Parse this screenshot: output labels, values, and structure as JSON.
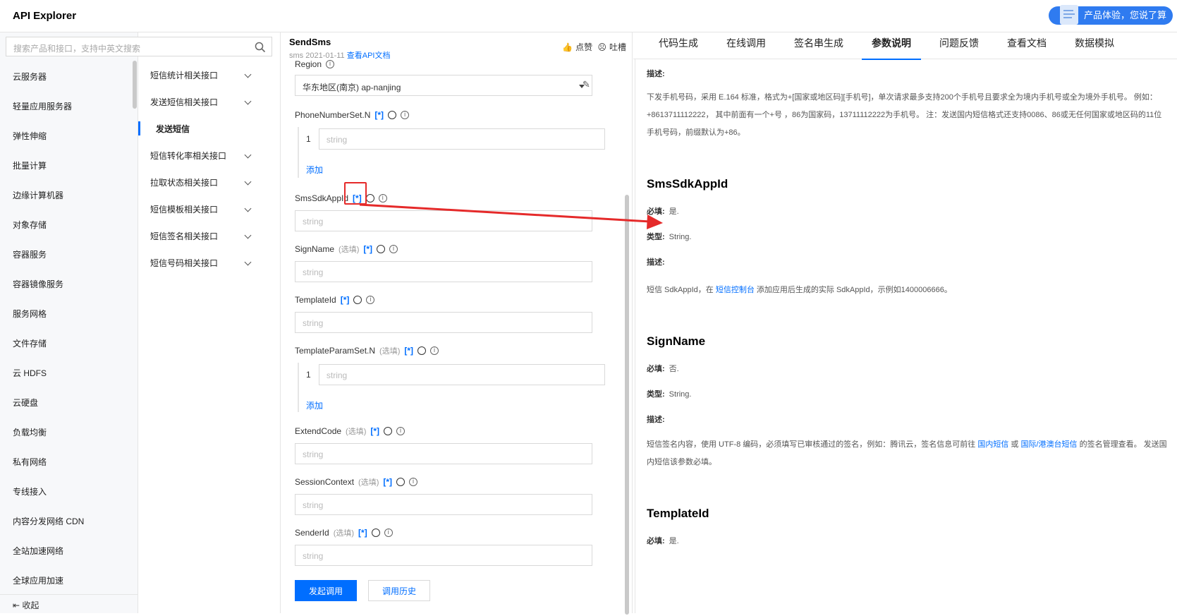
{
  "app": {
    "title": "API Explorer",
    "feedback_label": "产品体验，您说了算"
  },
  "search": {
    "placeholder": "搜索产品和接口，支持中英文搜索"
  },
  "products": [
    "云服务器",
    "轻量应用服务器",
    "弹性伸缩",
    "批量计算",
    "边缘计算机器",
    "对象存储",
    "容器服务",
    "容器镜像服务",
    "服务网格",
    "文件存储",
    "云 HDFS",
    "云硬盘",
    "负载均衡",
    "私有网络",
    "专线接入",
    "内容分发网络 CDN",
    "全站加速网络",
    "全球应用加速"
  ],
  "collapse_label": "收起",
  "api_groups": [
    {
      "label": "短信统计相关接口",
      "expandable": true
    },
    {
      "label": "发送短信相关接口",
      "expandable": true
    },
    {
      "label": "发送短信",
      "expandable": false,
      "active": true
    },
    {
      "label": "短信转化率相关接口",
      "expandable": true
    },
    {
      "label": "拉取状态相关接口",
      "expandable": true
    },
    {
      "label": "短信模板相关接口",
      "expandable": true
    },
    {
      "label": "短信签名相关接口",
      "expandable": true
    },
    {
      "label": "短信号码相关接口",
      "expandable": true
    }
  ],
  "api": {
    "name": "SendSms",
    "version": "sms 2021-01-11",
    "doc_link": "查看API文档",
    "like": "点赞",
    "complain": "吐槽"
  },
  "form": {
    "region_label": "Region",
    "region_value": "华东地区(南京) ap-nanjing",
    "tag": "[*]",
    "placeholder": "string",
    "optional": "(选填)",
    "add": "添加",
    "index": "1",
    "fields": {
      "phone": "PhoneNumberSet.N",
      "sdkappid": "SmsSdkAppId",
      "signname": "SignName",
      "templateid": "TemplateId",
      "templateparam": "TemplateParamSet.N",
      "extendcode": "ExtendCode",
      "sessioncontext": "SessionContext",
      "senderid": "SenderId"
    },
    "submit": "发起调用",
    "history": "调用历史"
  },
  "tabs": [
    "代码生成",
    "在线调用",
    "签名串生成",
    "参数说明",
    "问题反馈",
    "查看文档",
    "数据模拟"
  ],
  "active_tab": "参数说明",
  "doc": {
    "desc_label": "描述:",
    "required_label": "必填:",
    "type_label": "类型:",
    "phone_desc": "下发手机号码，采用 E.164 标准，格式为+[国家或地区码][手机号]，单次请求最多支持200个手机号且要求全为境内手机号或全为境外手机号。 例如：+8613711112222， 其中前面有一个+号 ，86为国家码，13711112222为手机号。 注：发送国内短信格式还支持0086、86或无任何国家或地区码的11位手机号码，前缀默认为+86。",
    "sdk_title": "SmsSdkAppId",
    "sdk_required": "是.",
    "sdk_type": "String.",
    "sdk_desc_a": "短信 SdkAppId，在 ",
    "sdk_desc_link": "短信控制台",
    "sdk_desc_b": " 添加应用后生成的实际 SdkAppId，示例如1400006666。",
    "sign_title": "SignName",
    "sign_required": "否.",
    "sign_type": "String.",
    "sign_desc_a": "短信签名内容，使用 UTF-8 编码，必须填写已审核通过的签名，例如：腾讯云，签名信息可前往 ",
    "sign_link1": "国内短信",
    "sign_or": " 或 ",
    "sign_link2": "国际/港澳台短信",
    "sign_desc_b": " 的签名管理查看。 发送国内短信该参数必填。",
    "tpl_title": "TemplateId",
    "tpl_required": "是."
  },
  "colors": {
    "accent": "#006eff",
    "highlight": "#e52a2a"
  }
}
